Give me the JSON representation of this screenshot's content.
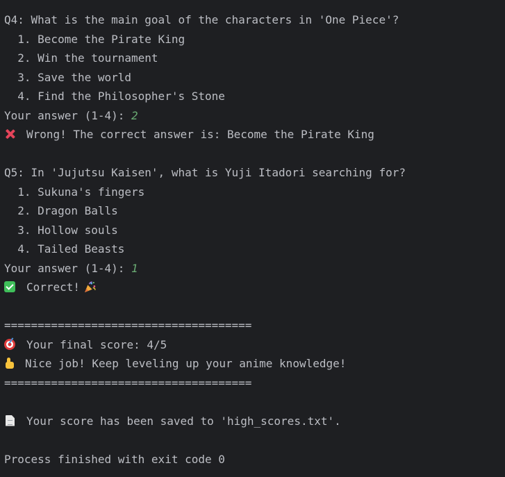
{
  "console": {
    "q4": {
      "question": "Q4: What is the main goal of the characters in 'One Piece'?",
      "options": [
        "  1. Become the Pirate King",
        "  2. Win the tournament",
        "  3. Save the world",
        "  4. Find the Philosopher's Stone"
      ],
      "prompt": "Your answer (1-4): ",
      "answer": "2",
      "result": "Wrong! The correct answer is: Become the Pirate King",
      "result_icon": "red-cross-icon"
    },
    "q5": {
      "question": "Q5: In 'Jujutsu Kaisen', what is Yuji Itadori searching for?",
      "options": [
        "  1. Sukuna's fingers",
        "  2. Dragon Balls",
        "  3. Hollow souls",
        "  4. Tailed Beasts"
      ],
      "prompt": "Your answer (1-4): ",
      "answer": "1",
      "result": "Correct!",
      "result_icon": "green-check-icon",
      "party_icon": "party-popper-icon"
    },
    "divider": "=====================================",
    "final_score": "Your final score: 4/5",
    "final_score_icon": "target-icon",
    "feedback": "Nice job! Keep leveling up your anime knowledge!",
    "feedback_icon": "thumbs-up-icon",
    "saved_message": "Your score has been saved to 'high_scores.txt'.",
    "saved_icon": "document-icon",
    "process_message": "Process finished with exit code 0"
  },
  "colors": {
    "background": "#1e1f22",
    "text": "#bcbec4",
    "input": "#6aab73",
    "error": "#e5445a",
    "success": "#3fbf5a"
  }
}
